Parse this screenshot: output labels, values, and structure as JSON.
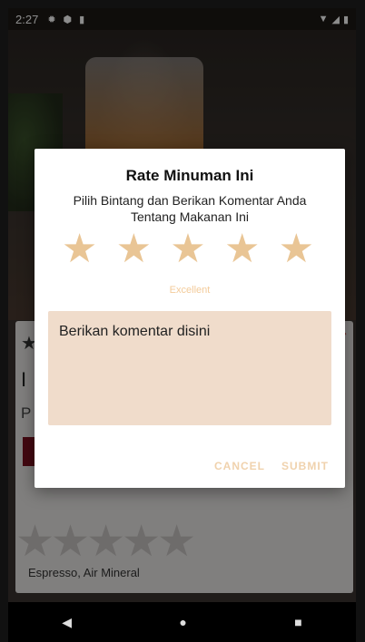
{
  "statusbar": {
    "time": "2:27",
    "icons": [
      "gear-icon",
      "shield-icon",
      "sim-card-icon"
    ],
    "right_icons": [
      "wifi-icon",
      "signal-icon",
      "battery-icon"
    ]
  },
  "background_card": {
    "description": "Espresso, Air Mineral"
  },
  "dialog": {
    "title": "Rate Minuman Ini",
    "subtitle": "Pilih Bintang dan Berikan Komentar Anda Tentang Makanan Ini",
    "rating": 5,
    "max_rating": 5,
    "rating_label": "Excellent",
    "comment_placeholder": "Berikan komentar disini",
    "comment_value": "",
    "cancel_label": "CANCEL",
    "submit_label": "SUBMIT",
    "star_color": "#e9c595",
    "button_color": "#f0d2ad",
    "input_bg": "#f0dccb"
  },
  "navbar": {
    "back": "◀",
    "home": "●",
    "recents": "■"
  }
}
